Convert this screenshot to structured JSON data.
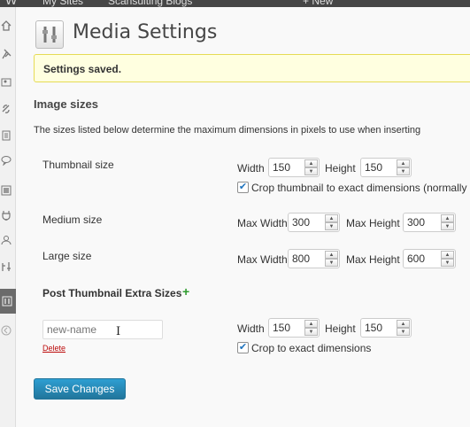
{
  "adminbar": {
    "wp_glyph": "W",
    "sites_label": "My Sites",
    "site_label": "Scansulting Blogs",
    "new_label": "+ New"
  },
  "page": {
    "title": "Media Settings",
    "icon": "media-settings-icon"
  },
  "notice": {
    "text": "Settings saved."
  },
  "image_sizes": {
    "heading": "Image sizes",
    "description": "The sizes listed below determine the maximum dimensions in pixels to use when inserting",
    "thumbnail": {
      "label": "Thumbnail size",
      "width_label": "Width",
      "width": "150",
      "height_label": "Height",
      "height": "150",
      "crop_label": "Crop thumbnail to exact dimensions (normally",
      "crop_checked": true
    },
    "medium": {
      "label": "Medium size",
      "width_label": "Max Width",
      "width": "300",
      "height_label": "Max Height",
      "height": "300"
    },
    "large": {
      "label": "Large size",
      "width_label": "Max Width",
      "width": "800",
      "height_label": "Max Height",
      "height": "600"
    }
  },
  "extra_sizes": {
    "heading": "Post Thumbnail Extra Sizes",
    "add_glyph": "+",
    "name_placeholder": "new-name",
    "delete_label": "Delete",
    "width_label": "Width",
    "width": "150",
    "height_label": "Height",
    "height": "150",
    "crop_label": "Crop to exact dimensions",
    "crop_checked": true
  },
  "save_button": "Save Changes",
  "colors": {
    "accent": "#21759b",
    "notice_bg": "#ffffe0",
    "notice_border": "#e6db55",
    "delete": "#bc0b0b",
    "add": "#2e9b2e"
  }
}
